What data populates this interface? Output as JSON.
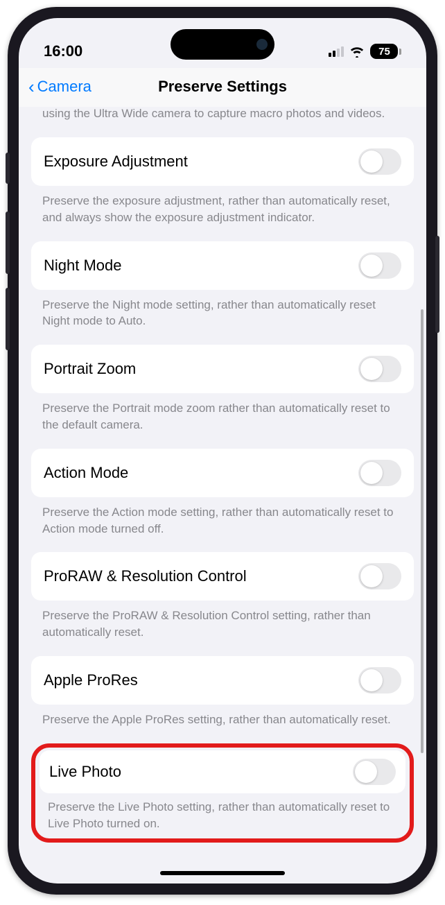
{
  "status": {
    "time": "16:00",
    "battery": "75"
  },
  "nav": {
    "back": "Camera",
    "title": "Preserve Settings"
  },
  "partial_footer_top": "using the Ultra Wide camera to capture macro photos and videos.",
  "settings": {
    "exposure": {
      "label": "Exposure Adjustment",
      "footer": "Preserve the exposure adjustment, rather than automatically reset, and always show the exposure adjustment indicator."
    },
    "night": {
      "label": "Night Mode",
      "footer": "Preserve the Night mode setting, rather than automatically reset Night mode to Auto."
    },
    "portrait": {
      "label": "Portrait Zoom",
      "footer": "Preserve the Portrait mode zoom rather than automatically reset to the default camera."
    },
    "action": {
      "label": "Action Mode",
      "footer": "Preserve the Action mode setting, rather than automatically reset to Action mode turned off."
    },
    "proraw": {
      "label": "ProRAW & Resolution Control",
      "footer": "Preserve the ProRAW & Resolution Control setting, rather than automatically reset."
    },
    "prores": {
      "label": "Apple ProRes",
      "footer": "Preserve the Apple ProRes setting, rather than automatically reset."
    },
    "livephoto": {
      "label": "Live Photo",
      "footer": "Preserve the Live Photo setting, rather than automatically reset to Live Photo turned on."
    }
  }
}
